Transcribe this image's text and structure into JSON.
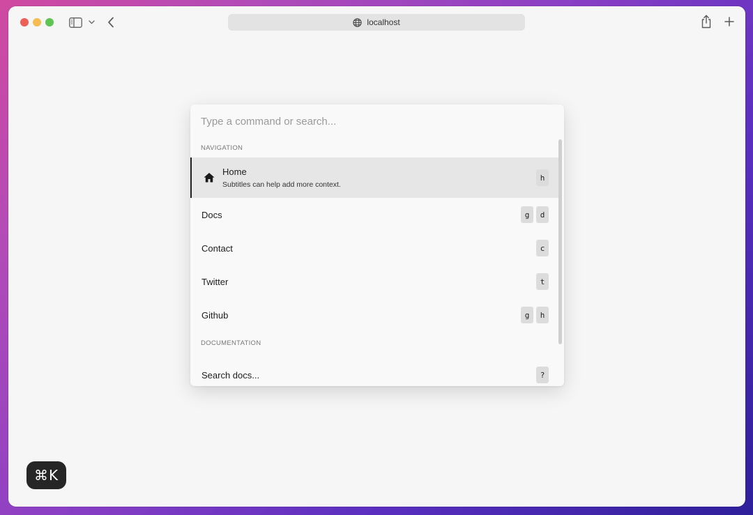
{
  "browser": {
    "url": "localhost"
  },
  "palette": {
    "search_placeholder": "Type a command or search...",
    "sections": [
      {
        "label": "NAVIGATION",
        "items": [
          {
            "title": "Home",
            "subtitle": "Subtitles can help add more context.",
            "icon": "home-icon",
            "shortcut": [
              "h"
            ],
            "active": true
          },
          {
            "title": "Docs",
            "shortcut": [
              "g",
              "d"
            ]
          },
          {
            "title": "Contact",
            "shortcut": [
              "c"
            ]
          },
          {
            "title": "Twitter",
            "shortcut": [
              "t"
            ]
          },
          {
            "title": "Github",
            "shortcut": [
              "g",
              "h"
            ]
          }
        ]
      },
      {
        "label": "DOCUMENTATION",
        "items": [
          {
            "title": "Search docs...",
            "shortcut": [
              "?"
            ]
          }
        ]
      }
    ]
  },
  "badge": {
    "label": "⌘K"
  },
  "colors": {
    "active_row": "#e6e6e6",
    "active_marker": "#222222",
    "kbd_background": "#dcdcdc",
    "badge_background": "#262626"
  }
}
